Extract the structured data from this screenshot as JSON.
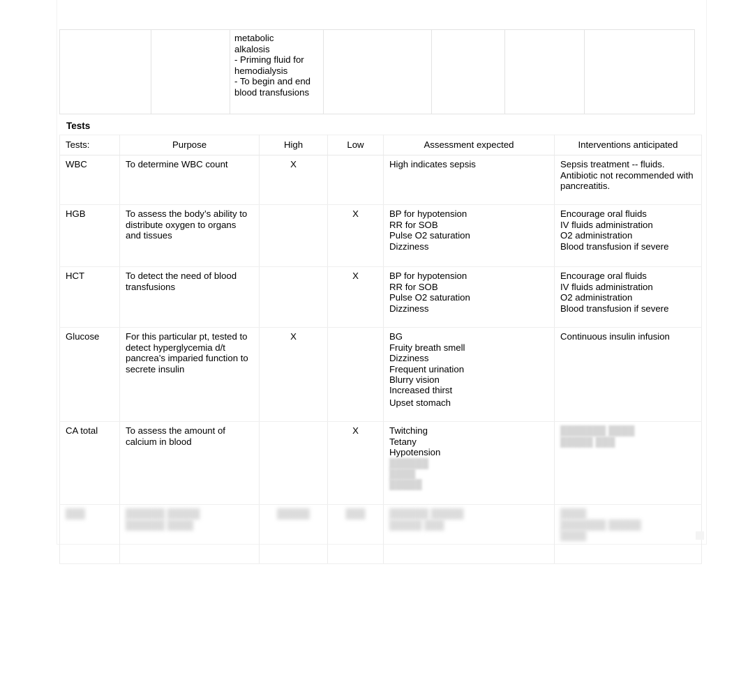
{
  "document": {
    "top_table_fragment": {
      "cells": [
        "",
        "",
        "",
        "",
        "",
        "",
        ""
      ],
      "text_cell_index": 2,
      "text_lines": [
        "metabolic",
        "alkalosis",
        "- Priming fluid for",
        "hemodialysis",
        "- To begin and end",
        "blood transfusions"
      ]
    },
    "section_heading": "Tests",
    "tests_table": {
      "headers": [
        "Tests:",
        "Purpose",
        "High",
        "Low",
        "Assessment expected",
        "Interventions anticipated"
      ],
      "rows": [
        {
          "test": "WBC",
          "purpose": [
            "To determine WBC count"
          ],
          "high": "X",
          "low": "",
          "assessment": [
            "High indicates sepsis"
          ],
          "interventions": [
            "Sepsis treatment -- fluids.",
            "Antibiotic not recommended with",
            "pancreatitis."
          ]
        },
        {
          "test": "HGB",
          "purpose": [
            "To assess the body’s ability to",
            "distribute oxygen to organs",
            "and tissues"
          ],
          "high": "",
          "low": "X",
          "assessment": [
            "BP for hypotension",
            "RR for SOB",
            "Pulse O2 saturation",
            "Dizziness"
          ],
          "interventions": [
            "Encourage oral fluids",
            "IV fluids administration",
            "O2 administration",
            "Blood transfusion if severe"
          ]
        },
        {
          "test": "HCT",
          "purpose": [
            "To detect the need of blood",
            "transfusions"
          ],
          "high": "",
          "low": "X",
          "assessment": [
            "BP for hypotension",
            "RR for SOB",
            "Pulse O2 saturation",
            "Dizziness"
          ],
          "interventions": [
            "Encourage oral fluids",
            "IV fluids administration",
            "O2 administration",
            "Blood transfusion if severe"
          ]
        },
        {
          "test": "Glucose",
          "purpose": [
            "For this particular pt, tested to",
            "detect hyperglycemia d/t",
            "pancrea’s imparied function to",
            "secrete insulin"
          ],
          "high": "X",
          "low": "",
          "assessment": [
            "BG",
            "Fruity breath smell",
            "Dizziness",
            "Frequent urination",
            "Blurry vision",
            "Increased thirst",
            "Upset stomach"
          ],
          "interventions": [
            "Continuous insulin infusion"
          ]
        },
        {
          "test": "CA total",
          "purpose": [
            "To assess the amount of",
            "calcium in blood"
          ],
          "high": "",
          "low": "X",
          "assessment": [
            "Twitching",
            "Tetany",
            "Hypotension"
          ],
          "assessment_faded": [
            "██████",
            "████",
            "█████"
          ],
          "interventions": [],
          "interventions_faded": [
            "███████ ████",
            "█████ ███"
          ]
        },
        {
          "test": "",
          "test_faded": [
            "███"
          ],
          "purpose": [],
          "purpose_faded": [
            "██████ █████",
            "██████ ████"
          ],
          "high": "",
          "high_faded": [
            "█████"
          ],
          "low": "",
          "low_faded": [
            "███"
          ],
          "assessment": [],
          "assessment_faded": [
            "██████ █████",
            "█████ ███"
          ],
          "interventions": [],
          "interventions_faded": [
            "████",
            "███████ █████",
            "████"
          ]
        }
      ]
    }
  }
}
